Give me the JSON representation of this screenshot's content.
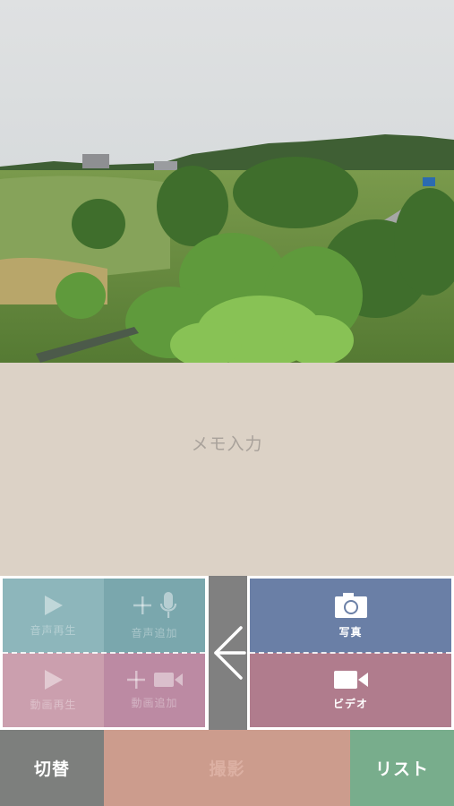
{
  "memo": {
    "placeholder": "メモ入力"
  },
  "audio": {
    "play_label": "音声再生",
    "add_label": "音声追加"
  },
  "video_group": {
    "play_label": "動画再生",
    "add_label": "動画追加"
  },
  "capture": {
    "photo_label": "写真",
    "video_label": "ビデオ"
  },
  "bottom_bar": {
    "switch_label": "切替",
    "shoot_label": "撮影",
    "list_label": "リスト"
  },
  "icons": {
    "play": "play-icon",
    "plus": "plus-icon",
    "mic": "microphone-icon",
    "camcorder": "video-camera-icon",
    "camera": "camera-icon",
    "back": "back-arrow-icon"
  },
  "colors": {
    "memo_bg": "#dcd2c6",
    "audio_play_bg": "#8db6bb",
    "audio_add_bg": "#7aa7ad",
    "video_play_bg": "#cb9fae",
    "video_add_bg": "#bc8aa3",
    "divider_bg": "#808080",
    "photo_bg": "#6a7fa6",
    "video_bg": "#b07c8d",
    "switch_bg": "#7d7f7d",
    "shoot_bg": "#cc9c8d",
    "list_bg": "#78ad8c"
  }
}
